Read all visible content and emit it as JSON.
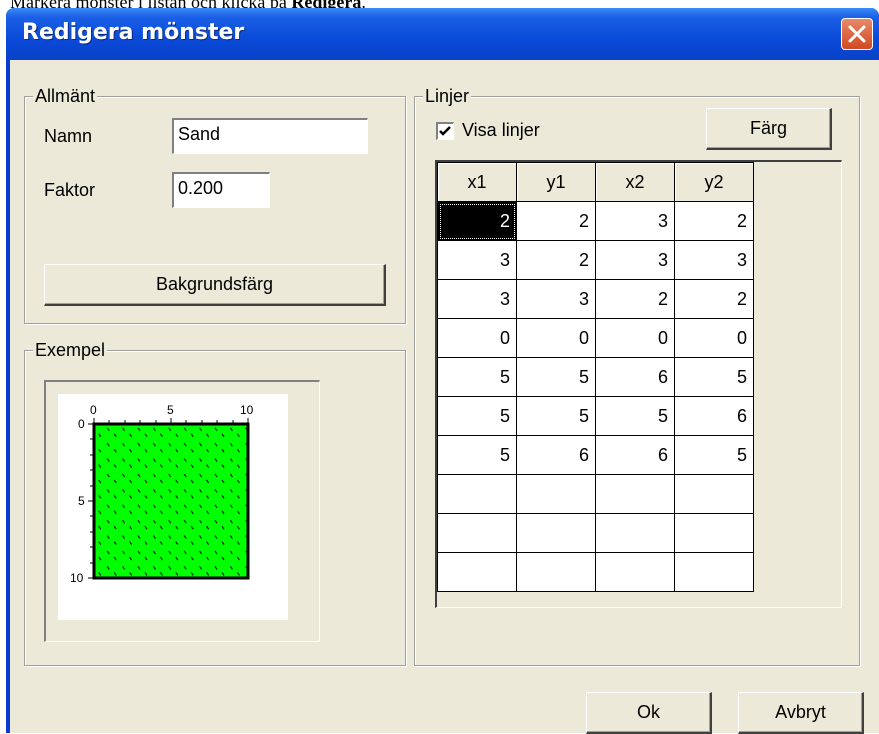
{
  "doc_text": {
    "before": "Markera mönster i listan och klicka på ",
    "bold": "Redigera",
    "after": "."
  },
  "window": {
    "title": "Redigera mönster"
  },
  "general": {
    "label": "Allmänt",
    "name_label": "Namn",
    "name_value": "Sand",
    "factor_label": "Faktor",
    "factor_value": "0.200",
    "bg_button": "Bakgrundsfärg"
  },
  "example": {
    "label": "Exempel",
    "x_ticks": [
      "0",
      "5",
      "10"
    ],
    "y_ticks": [
      "0",
      "5",
      "10"
    ],
    "fill_color": "#00ff00"
  },
  "lines": {
    "label": "Linjer",
    "show_lines_label": "Visa linjer",
    "show_lines_checked": true,
    "color_button": "Färg",
    "columns": [
      "x1",
      "y1",
      "x2",
      "y2"
    ],
    "rows": [
      [
        "2",
        "2",
        "3",
        "2"
      ],
      [
        "3",
        "2",
        "3",
        "3"
      ],
      [
        "3",
        "3",
        "2",
        "2"
      ],
      [
        "0",
        "0",
        "0",
        "0"
      ],
      [
        "5",
        "5",
        "6",
        "5"
      ],
      [
        "5",
        "5",
        "5",
        "6"
      ],
      [
        "5",
        "6",
        "6",
        "5"
      ],
      [
        "",
        "",
        "",
        ""
      ],
      [
        "",
        "",
        "",
        ""
      ],
      [
        "",
        "",
        "",
        ""
      ]
    ]
  },
  "buttons": {
    "ok": "Ok",
    "cancel": "Avbryt"
  }
}
